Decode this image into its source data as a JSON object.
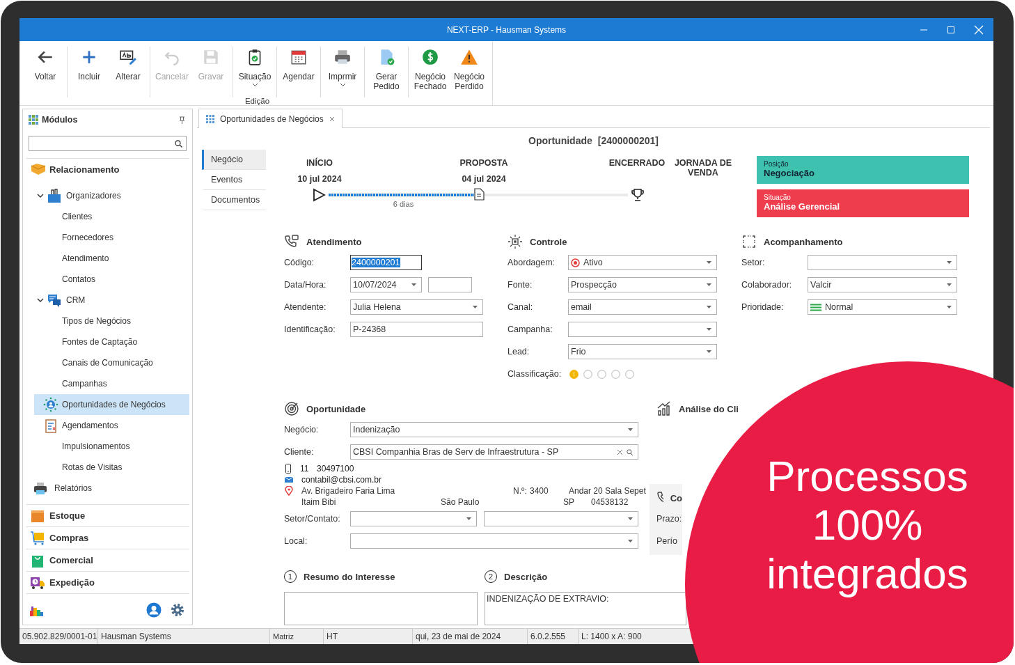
{
  "window": {
    "title": "NEXT-ERP - Hausman Systems"
  },
  "toolbar": {
    "group_label": "Edição",
    "groups": [
      {
        "buttons": [
          {
            "label": "Voltar",
            "disabled": false,
            "has_menu": false
          }
        ]
      },
      {
        "buttons": [
          {
            "label": "Incluir",
            "disabled": false,
            "has_menu": false
          },
          {
            "label": "Alterar",
            "disabled": false,
            "has_menu": false
          }
        ]
      },
      {
        "buttons": [
          {
            "label": "Cancelar",
            "disabled": true,
            "has_menu": false
          },
          {
            "label": "Gravar",
            "disabled": true,
            "has_menu": false
          }
        ]
      },
      {
        "buttons": [
          {
            "label": "Situação",
            "disabled": false,
            "has_menu": true
          }
        ]
      },
      {
        "buttons": [
          {
            "label": "Agendar",
            "disabled": false,
            "has_menu": false
          }
        ]
      },
      {
        "buttons": [
          {
            "label": "Imprmir",
            "disabled": false,
            "has_menu": true
          }
        ]
      },
      {
        "buttons": [
          {
            "label": "Gerar Pedido",
            "disabled": false,
            "has_menu": false
          }
        ]
      },
      {
        "buttons": [
          {
            "label": "Negócio Fechado",
            "disabled": false,
            "has_menu": false
          },
          {
            "label": "Negócio Perdido",
            "disabled": false,
            "has_menu": false
          }
        ]
      }
    ]
  },
  "sidebar": {
    "title": "Módulos",
    "tree": [
      {
        "label": "Relacionamento",
        "selected": false,
        "children": [
          {
            "label": "Organizadores",
            "expanded": true,
            "selected": false,
            "children": [
              {
                "label": "Clientes",
                "selected": false
              },
              {
                "label": "Fornecedores",
                "selected": false
              },
              {
                "label": "Atendimento",
                "selected": false
              },
              {
                "label": "Contatos",
                "selected": false
              }
            ]
          },
          {
            "label": "CRM",
            "expanded": true,
            "selected": false,
            "children": [
              {
                "label": "Tipos de Negócios",
                "selected": false
              },
              {
                "label": "Fontes de Captação",
                "selected": false
              },
              {
                "label": "Canais de Comunicação",
                "selected": false
              },
              {
                "label": "Campanhas",
                "selected": false
              },
              {
                "label": "Oportunidades de Negócios",
                "selected": true
              },
              {
                "label": "Agendamentos",
                "selected": false
              },
              {
                "label": "Impulsionamentos",
                "selected": false
              },
              {
                "label": "Rotas de Visitas",
                "selected": false
              }
            ]
          },
          {
            "label": "Relatórios",
            "selected": false
          }
        ]
      }
    ],
    "modules": [
      "Estoque",
      "Compras",
      "Comercial",
      "Expedição"
    ]
  },
  "document_tab": {
    "label": "Oportunidades de Negócios",
    "selected": true
  },
  "title": "Oportunidade",
  "code": "[2400000201]",
  "nav": [
    {
      "label": "Negócio",
      "selected": true
    },
    {
      "label": "Eventos",
      "selected": false
    },
    {
      "label": "Documentos",
      "selected": false
    }
  ],
  "timeline": {
    "stages": [
      {
        "label": "INÍCIO",
        "date": "10 jul 2024"
      },
      {
        "label": "PROPOSTA",
        "date": "04 jul 2024"
      },
      {
        "label": "ENCERRADO"
      }
    ],
    "journey_label": "JORNADA DE VENDA",
    "level": 0.5,
    "duration": "6 dias"
  },
  "status_cards": [
    {
      "caption": "Posição",
      "value": "Negociação",
      "color": "#3fc1b0"
    },
    {
      "caption": "Situação",
      "value": "Análise Gerencial",
      "color": "#ee3e4e"
    }
  ],
  "sections": [
    {
      "title": "Atendimento",
      "fields": [
        {
          "label": "Código:",
          "kind": "text_selected",
          "value": "2400000201"
        },
        {
          "label": "Data/Hora:",
          "kind": "date_time",
          "value": "10/07/2024"
        },
        {
          "label": "Atendente:",
          "kind": "combo",
          "value": "Julia Helena"
        },
        {
          "label": "Identificação:",
          "kind": "text",
          "value": "P-24368"
        }
      ]
    },
    {
      "title": "Controle",
      "fields": [
        {
          "label": "Abordagem:",
          "kind": "combo_icon",
          "value": "Ativo"
        },
        {
          "label": "Fonte:",
          "kind": "combo",
          "value": "Prospecção"
        },
        {
          "label": "Canal:",
          "kind": "combo",
          "value": "email"
        },
        {
          "label": "Campanha:",
          "kind": "combo"
        },
        {
          "label": "Lead:",
          "kind": "combo",
          "value": "Frio"
        },
        {
          "label": "Classificação:",
          "kind": "rating",
          "stars": 1
        }
      ]
    },
    {
      "title": "Acompanhamento",
      "fields": [
        {
          "label": "Setor:",
          "kind": "combo"
        },
        {
          "label": "Colaborador:",
          "kind": "combo",
          "value": "Valcir"
        },
        {
          "label": "Prioridade:",
          "kind": "combo_icon",
          "value": "Normal"
        }
      ]
    },
    {
      "title": "Oportunidade",
      "fields": [
        {
          "label": "Negócio:",
          "kind": "combo",
          "value": "Indenização"
        },
        {
          "label": "Cliente:",
          "kind": "lookup",
          "value": "CBSI Companhia Bras de Serv de Infraestrutura - SP"
        },
        {
          "kind": "contact",
          "phone_area": "11",
          "phone": "30497100",
          "email": "contabil@cbsi.com.br",
          "street": "Av. Brigadeiro Faria Lima",
          "number_label": "N.º:",
          "number": "3400",
          "complement": "Andar 20 Sala Sepet",
          "district": "Itaim Bibi",
          "city": "São Paulo",
          "state": "SP",
          "zip": "04538132"
        },
        {
          "label": "Setor/Contato:",
          "kind": "combo_pair"
        },
        {
          "label": "Local:",
          "kind": "combo"
        }
      ]
    }
  ],
  "analysis": {
    "title": "Análise do Cli"
  },
  "contact_return": {
    "title": "Co",
    "deadline_label": "Prazo:",
    "period_label": "Perío"
  },
  "notes": [
    {
      "number": "1",
      "title": "Resumo do Interesse"
    },
    {
      "number": "2",
      "title": "Descrição",
      "text": "INDENIZAÇÃO DE EXTRAVIO:"
    }
  ],
  "status_bar": [
    "05.902.829/0001-01",
    "Hausman Systems",
    "Matriz",
    "HT",
    "qui, 23 de mai de 2024",
    "6.0.2.555",
    "L: 1400 x A: 900"
  ],
  "overlay": {
    "text": "Processos 100% integrados"
  }
}
